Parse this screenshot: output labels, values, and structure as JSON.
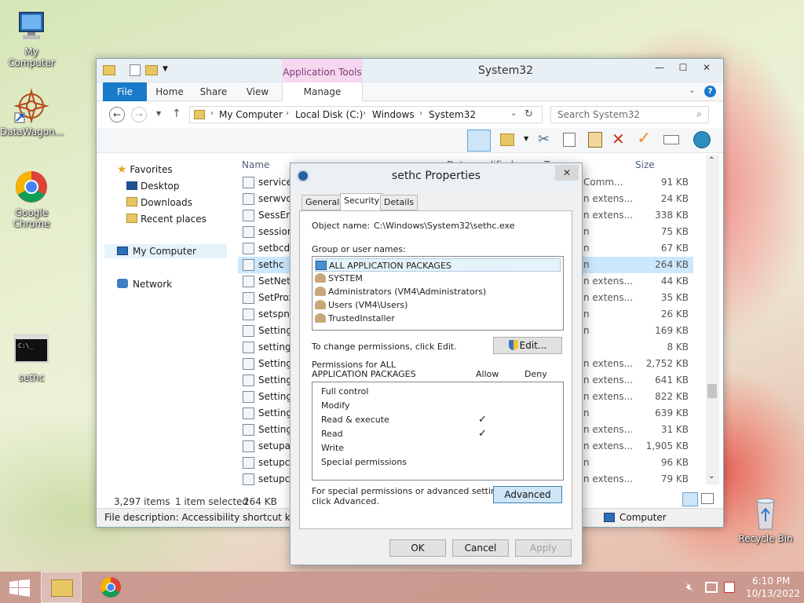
{
  "desktop": {
    "icons": [
      {
        "label": "My Computer"
      },
      {
        "label": "DataWagon..."
      },
      {
        "label": "Google Chrome"
      },
      {
        "label": "sethc"
      },
      {
        "label": "Recycle Bin"
      }
    ]
  },
  "explorer": {
    "title": "System32",
    "app_tools": "Application Tools",
    "tabs": [
      "File",
      "Home",
      "Share",
      "View",
      "Manage"
    ],
    "breadcrumb": [
      "My Computer",
      "Local Disk (C:)",
      "Windows",
      "System32"
    ],
    "search_placeholder": "Search System32",
    "nav": {
      "favorites": "Favorites",
      "desktop": "Desktop",
      "downloads": "Downloads",
      "recent": "Recent places",
      "computer": "My Computer",
      "network": "Network"
    },
    "columns": {
      "name": "Name",
      "date": "Date modified",
      "type": "Type",
      "size": "Size"
    },
    "files": [
      {
        "name": "services",
        "type": "Comm...",
        "size": "91 KB"
      },
      {
        "name": "serwvdr",
        "type": "n extens...",
        "size": "24 KB"
      },
      {
        "name": "SessEnv",
        "type": "n extens...",
        "size": "338 KB"
      },
      {
        "name": "session",
        "type": "n",
        "size": "75 KB"
      },
      {
        "name": "setbcdle",
        "type": "n",
        "size": "67 KB"
      },
      {
        "name": "sethc",
        "type": "n",
        "size": "264 KB"
      },
      {
        "name": "SetNetw",
        "type": "n extens...",
        "size": "44 KB"
      },
      {
        "name": "SetProx",
        "type": "n extens...",
        "size": "35 KB"
      },
      {
        "name": "setspn",
        "type": "n",
        "size": "26 KB"
      },
      {
        "name": "Setting",
        "type": "n",
        "size": "169 KB"
      },
      {
        "name": "settings",
        "type": "",
        "size": "8 KB"
      },
      {
        "name": "Settings",
        "type": "n extens...",
        "size": "2,752 KB"
      },
      {
        "name": "Settings",
        "type": "n extens...",
        "size": "641 KB"
      },
      {
        "name": "Settings",
        "type": "n extens...",
        "size": "822 KB"
      },
      {
        "name": "Settings",
        "type": "n",
        "size": "639 KB"
      },
      {
        "name": "Settings",
        "type": "n extens...",
        "size": "31 KB"
      },
      {
        "name": "setupap",
        "type": "n extens...",
        "size": "1,905 KB"
      },
      {
        "name": "setupcl",
        "type": "n",
        "size": "96 KB"
      },
      {
        "name": "setupcl",
        "type": "n extens...",
        "size": "79 KB"
      }
    ],
    "status": {
      "count": "3,297 items",
      "selected": "1 item selected",
      "size": "264 KB"
    },
    "description": "File description: Accessibility shortcut keys, C",
    "description_right": "Computer"
  },
  "dialog": {
    "title": "sethc Properties",
    "tabs": [
      "General",
      "Security",
      "Details"
    ],
    "object_label": "Object name:",
    "object_value": "C:\\Windows\\System32\\sethc.exe",
    "group_label": "Group or user names:",
    "groups": [
      "ALL APPLICATION PACKAGES",
      "SYSTEM",
      "Administrators (VM4\\Administrators)",
      "Users (VM4\\Users)",
      "TrustedInstaller"
    ],
    "change_text": "To change permissions, click Edit.",
    "edit_btn": "Edit...",
    "perm_header_1": "Permissions for ALL",
    "perm_header_2": "APPLICATION PACKAGES",
    "allow": "Allow",
    "deny": "Deny",
    "permissions": [
      {
        "name": "Full control",
        "allow": false
      },
      {
        "name": "Modify",
        "allow": false
      },
      {
        "name": "Read & execute",
        "allow": true
      },
      {
        "name": "Read",
        "allow": true
      },
      {
        "name": "Write",
        "allow": false
      },
      {
        "name": "Special permissions",
        "allow": false
      }
    ],
    "check_mark": "✓",
    "adv_text_1": "For special permissions or advanced settings,",
    "adv_text_2": "click Advanced.",
    "advanced_btn": "Advanced",
    "ok": "OK",
    "cancel": "Cancel",
    "apply": "Apply"
  },
  "taskbar": {
    "time": "6:10 PM",
    "date": "10/13/2022"
  }
}
